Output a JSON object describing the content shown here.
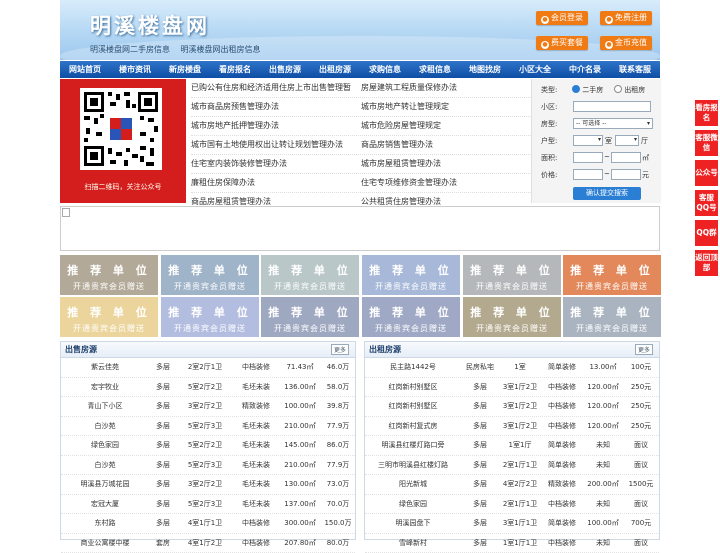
{
  "header": {
    "title": "明溪楼盘网",
    "sublinks": [
      "明溪楼盘网二手房信息",
      "明溪楼盘网出租房信息"
    ],
    "buttons": [
      "会员登录",
      "免费注册",
      "费买套餐",
      "金币充值"
    ]
  },
  "nav": [
    "网站首页",
    "楼市资讯",
    "新房楼盘",
    "看房报名",
    "出售房源",
    "出租房源",
    "求购信息",
    "求租信息",
    "地图找房",
    "小区大全",
    "中介名录",
    "联系客服"
  ],
  "qr": {
    "caption": "扫描二维码，关注公众号"
  },
  "links": [
    [
      "已购公有住房和经济适用住房上市出售管理暂",
      "房屋建筑工程质量保修办法"
    ],
    [
      "城市商品房预售管理办法",
      "城市房地产转让管理规定"
    ],
    [
      "城市房地产抵押管理办法",
      "城市危险房屋管理规定"
    ],
    [
      "城市国有土地使用权出让转让规划管理办法",
      "商品房销售管理办法"
    ],
    [
      "住宅室内装饰装修管理办法",
      "城市房屋租赁管理办法"
    ],
    [
      "廉租住房保障办法",
      "住宅专项维修资金管理办法"
    ],
    [
      "商品房屋租赁管理办法",
      "公共租赁住房管理办法"
    ]
  ],
  "search": {
    "type_label": "类型:",
    "opt_sale": "二手房",
    "opt_rent": "出租房",
    "community_label": "小区:",
    "room_label": "房型:",
    "room_select": "-- 可选择 --",
    "layout_label": "户型:",
    "layout_unit": "室",
    "hall_unit": "厅",
    "area_label": "面积:",
    "area_unit": "㎡",
    "price_label": "价格:",
    "price_unit": "元",
    "submit": "确认提交搜索"
  },
  "recommend": {
    "title": "推 荐 单 位",
    "sub": "开通贵宾会员赠送",
    "colors": [
      "#b3a998",
      "#9fb3c9",
      "#b9c7c8",
      "#a7b8d8",
      "#b5b8ba",
      "#e2885a",
      "#ecd59d",
      "#b3bde0",
      "#9fa8c1",
      "#9fa8c4",
      "#b3a98e",
      "#aab4c0"
    ]
  },
  "sale": {
    "title": "出售房源",
    "more": "更多",
    "rows": [
      [
        "紫云佳苑",
        "多层",
        "2室2厅1卫",
        "中档装修",
        "71.43㎡",
        "46.0万"
      ],
      [
        "宏宇牧业",
        "多层",
        "5室2厅2卫",
        "毛坯未装",
        "136.00㎡",
        "58.0万"
      ],
      [
        "青山下小区",
        "多层",
        "3室2厅2卫",
        "精致装修",
        "100.00㎡",
        "39.8万"
      ],
      [
        "白沙苑",
        "多层",
        "5室2厅3卫",
        "毛坯未装",
        "210.00㎡",
        "77.9万"
      ],
      [
        "绿色家园",
        "多层",
        "5室2厅2卫",
        "毛坯未装",
        "145.00㎡",
        "86.0万"
      ],
      [
        "白沙苑",
        "多层",
        "5室2厅3卫",
        "毛坯未装",
        "210.00㎡",
        "77.9万"
      ],
      [
        "明溪县万城花园",
        "多层",
        "3室2厅2卫",
        "毛坯未装",
        "130.00㎡",
        "73.0万"
      ],
      [
        "宏冠大厦",
        "多层",
        "5室2厅3卫",
        "毛坯未装",
        "137.00㎡",
        "70.0万"
      ],
      [
        "东村路",
        "多层",
        "4室1厅1卫",
        "中档装修",
        "300.00㎡",
        "150.0万"
      ],
      [
        "商业公寓楼中楼",
        "套房",
        "4室1厅2卫",
        "中档装修",
        "207.80㎡",
        "80.0万"
      ]
    ]
  },
  "rent": {
    "title": "出租房源",
    "more": "更多",
    "rows": [
      [
        "民主路1442号",
        "民房私宅",
        "1室",
        "简单装修",
        "13.00㎡",
        "100元"
      ],
      [
        "红岗新村别墅区",
        "多层",
        "3室1厅2卫",
        "中档装修",
        "120.00㎡",
        "250元"
      ],
      [
        "红岗新村别墅区",
        "多层",
        "3室1厅2卫",
        "中档装修",
        "120.00㎡",
        "250元"
      ],
      [
        "红岗新村复式房",
        "多层",
        "3室1厅2卫",
        "中档装修",
        "120.00㎡",
        "250元"
      ],
      [
        "明溪县红楼灯路口旁",
        "多层",
        "1室1厅",
        "简单装修",
        "未知",
        "面议"
      ],
      [
        "三明市明溪县红楼灯路",
        "多层",
        "2室1厅1卫",
        "简单装修",
        "未知",
        "面议"
      ],
      [
        "阳光新城",
        "多层",
        "4室2厅2卫",
        "精致装修",
        "200.00㎡",
        "1500元"
      ],
      [
        "绿色家园",
        "多层",
        "2室1厅1卫",
        "中档装修",
        "未知",
        "面议"
      ],
      [
        "明溪园盘下",
        "多层",
        "3室1厅1卫",
        "简单装修",
        "100.00㎡",
        "700元"
      ],
      [
        "雪峰新村",
        "多层",
        "1室1厅1卫",
        "中档装修",
        "未知",
        "面议"
      ]
    ]
  },
  "side": [
    "看房报名",
    "客服微信",
    "公众号",
    "客服QQ号",
    "QQ群",
    "返回顶部"
  ]
}
